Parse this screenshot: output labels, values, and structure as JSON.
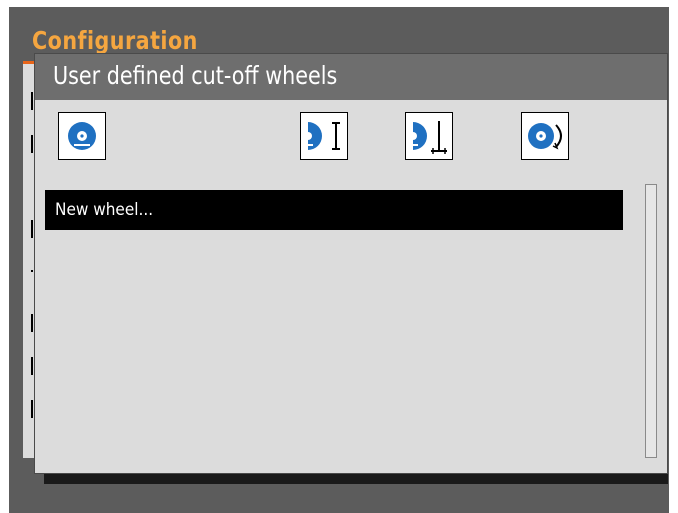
{
  "screen": {
    "title": "Configuration"
  },
  "dialog": {
    "title": "User defined cut-off wheels",
    "toolbar": [
      {
        "icon": "wheel-icon",
        "label": ""
      },
      {
        "icon": "wheel-thickness-icon",
        "label": ""
      },
      {
        "icon": "wheel-depth-icon",
        "label": ""
      },
      {
        "icon": "wheel-rotation-icon",
        "label": ""
      }
    ],
    "list": {
      "items": [
        {
          "label": "New wheel..."
        }
      ],
      "selected_index": 0
    }
  },
  "colors": {
    "accent": "#f5a640",
    "accent_line": "#e8651a",
    "title_bar": "#6e6e6e",
    "dialog_bg": "#dcdcdc",
    "wheel_blue": "#1f70c1",
    "selection": "#000000"
  }
}
